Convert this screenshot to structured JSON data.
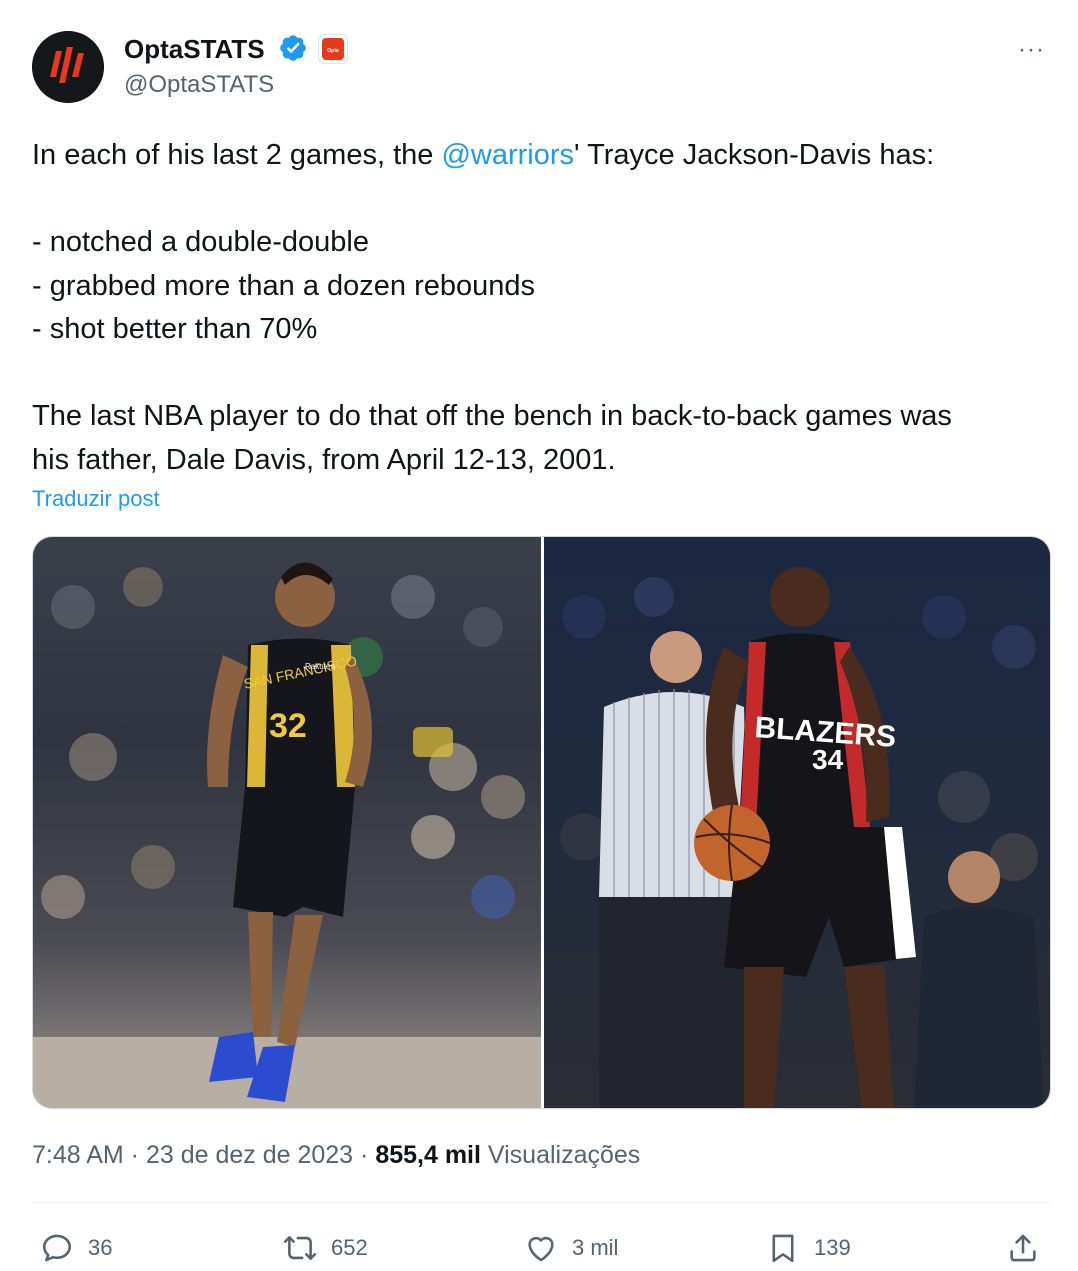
{
  "author": {
    "display_name": "OptaSTATS",
    "handle": "@OptaSTATS",
    "affiliate_label": "Opta",
    "more_label": "···"
  },
  "tweet": {
    "line1_pre": "In each of his last 2 games, the ",
    "line1_mention": "@warriors",
    "line1_post": "' Trayce Jackson-Davis has:",
    "bullets": [
      "- notched a double-double",
      "- grabbed more than a dozen rebounds",
      "- shot better than 70%"
    ],
    "para2_line1": "The last NBA player to do that off the bench in back-to-back games was",
    "para2_line2": "his father, Dale Davis, from April 12-13, 2001.",
    "translate": "Traduzir post"
  },
  "media": {
    "left": {
      "jersey_text": "SAN FRANCISCO",
      "jersey_number": "32",
      "sponsor": "Rakuten"
    },
    "right": {
      "jersey_text": "BLAZERS",
      "jersey_number": "34"
    }
  },
  "meta": {
    "time": "7:48 AM",
    "sep1": " · ",
    "date": "23 de dez de 2023",
    "sep2": " · ",
    "views_count": "855,4 mil",
    "views_label": " Visualizações"
  },
  "actions": {
    "replies": "36",
    "reposts": "652",
    "likes": "3 mil",
    "bookmarks": "139"
  },
  "colors": {
    "accent": "#1d9bf0",
    "text": "#0f1419",
    "secondary": "#536471"
  }
}
